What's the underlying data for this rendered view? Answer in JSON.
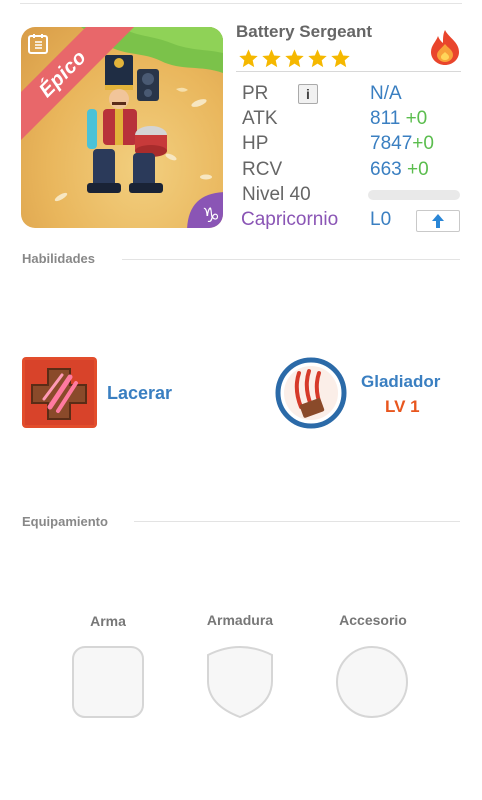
{
  "hero": {
    "name": "Battery Sergeant",
    "rarity": "Épico",
    "stars": 5,
    "element_icon": "fire-element-icon",
    "star_color": "#f5b800",
    "fire_color": "#e9452c"
  },
  "stats": {
    "pr_label": "PR",
    "pr_value": "N/A",
    "atk_label": "ATK",
    "atk_value": "811",
    "atk_bonus": "+0",
    "hp_label": "HP",
    "hp_value": "7847",
    "hp_bonus": "+0",
    "rcv_label": "RCV",
    "rcv_value": "663",
    "rcv_bonus": "+0",
    "level_label": "Nivel 40",
    "level_progress": 0,
    "constellation": "Capricornio",
    "constellation_level": "L0"
  },
  "sections": {
    "skills_title": "Habilidades",
    "equipment_title": "Equipamiento"
  },
  "skills": {
    "active_name": "Lacerar",
    "passive_name": "Gladiador",
    "passive_level": "LV 1"
  },
  "equipment": {
    "weapon_label": "Arma",
    "armor_label": "Armadura",
    "accessory_label": "Accesorio"
  },
  "colors": {
    "accent_blue": "#3a7fc1",
    "bonus_green": "#5bbd4e",
    "zodiac_purple": "#8a55b5",
    "level_orange": "#e8561e",
    "ribbon_red": "#e8676a"
  }
}
